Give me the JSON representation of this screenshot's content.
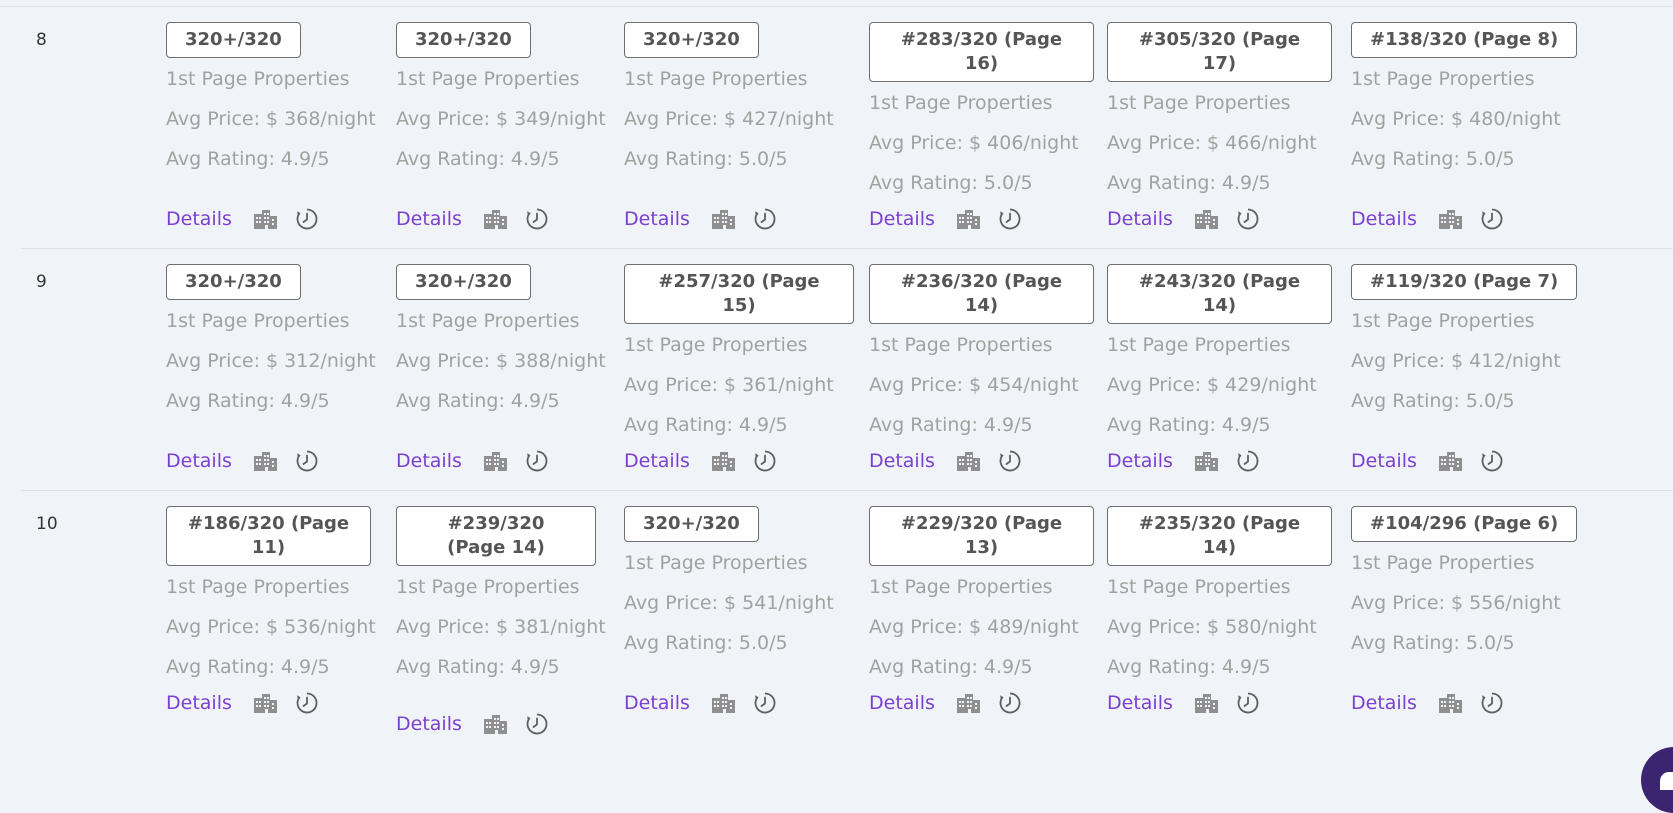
{
  "rows": [
    {
      "number": "8",
      "cells": [
        {
          "rank": "320+/320",
          "props": "1st Page Properties",
          "price": "Avg Price: $ 368/night",
          "rating": "Avg Rating: 4.9/5",
          "details": "Details"
        },
        {
          "rank": "320+/320",
          "props": "1st Page Properties",
          "price": "Avg Price: $ 349/night",
          "rating": "Avg Rating: 4.9/5",
          "details": "Details"
        },
        {
          "rank": "320+/320",
          "props": "1st Page Properties",
          "price": "Avg Price: $ 427/night",
          "rating": "Avg Rating: 5.0/5",
          "details": "Details"
        },
        {
          "rank": "#283/320 (Page 16)",
          "props": "1st Page Properties",
          "price": "Avg Price: $ 406/night",
          "rating": "Avg Rating: 5.0/5",
          "details": "Details"
        },
        {
          "rank": "#305/320 (Page 17)",
          "props": "1st Page Properties",
          "price": "Avg Price: $ 466/night",
          "rating": "Avg Rating: 4.9/5",
          "details": "Details"
        },
        {
          "rank": "#138/320 (Page 8)",
          "props": "1st Page Properties",
          "price": "Avg Price: $ 480/night",
          "rating": "Avg Rating: 5.0/5",
          "details": "Details"
        }
      ]
    },
    {
      "number": "9",
      "cells": [
        {
          "rank": "320+/320",
          "props": "1st Page Properties",
          "price": "Avg Price: $ 312/night",
          "rating": "Avg Rating: 4.9/5",
          "details": "Details"
        },
        {
          "rank": "320+/320",
          "props": "1st Page Properties",
          "price": "Avg Price: $ 388/night",
          "rating": "Avg Rating: 4.9/5",
          "details": "Details"
        },
        {
          "rank": "#257/320 (Page 15)",
          "props": "1st Page Properties",
          "price": "Avg Price: $ 361/night",
          "rating": "Avg Rating: 4.9/5",
          "details": "Details"
        },
        {
          "rank": "#236/320 (Page 14)",
          "props": "1st Page Properties",
          "price": "Avg Price: $ 454/night",
          "rating": "Avg Rating: 4.9/5",
          "details": "Details"
        },
        {
          "rank": "#243/320 (Page 14)",
          "props": "1st Page Properties",
          "price": "Avg Price: $ 429/night",
          "rating": "Avg Rating: 4.9/5",
          "details": "Details"
        },
        {
          "rank": "#119/320 (Page 7)",
          "props": "1st Page Properties",
          "price": "Avg Price: $ 412/night",
          "rating": "Avg Rating: 5.0/5",
          "details": "Details"
        }
      ]
    },
    {
      "number": "10",
      "cells": [
        {
          "rank": "#186/320 (Page 11)",
          "props": "1st Page Properties",
          "price": "Avg Price: $ 536/night",
          "rating": "Avg Rating: 4.9/5",
          "details": "Details"
        },
        {
          "rank": "#239/320 (Page 14)",
          "props": "1st Page Properties",
          "price": "Avg Price: $ 381/night",
          "rating": "Avg Rating: 4.9/5",
          "details": "Details"
        },
        {
          "rank": "320+/320",
          "props": "1st Page Properties",
          "price": "Avg Price: $ 541/night",
          "rating": "Avg Rating: 5.0/5",
          "details": "Details"
        },
        {
          "rank": "#229/320 (Page 13)",
          "props": "1st Page Properties",
          "price": "Avg Price: $ 489/night",
          "rating": "Avg Rating: 4.9/5",
          "details": "Details"
        },
        {
          "rank": "#235/320 (Page 14)",
          "props": "1st Page Properties",
          "price": "Avg Price: $ 580/night",
          "rating": "Avg Rating: 4.9/5",
          "details": "Details"
        },
        {
          "rank": "#104/296 (Page 6)",
          "props": "1st Page Properties",
          "price": "Avg Price: $ 556/night",
          "rating": "Avg Rating: 5.0/5",
          "details": "Details"
        }
      ]
    }
  ],
  "icons": {
    "building": "building-icon",
    "history": "history-clock-icon"
  },
  "colors": {
    "link": "#7b3fd1",
    "background": "#f0f4f8",
    "icon": "#8f8f8f"
  }
}
